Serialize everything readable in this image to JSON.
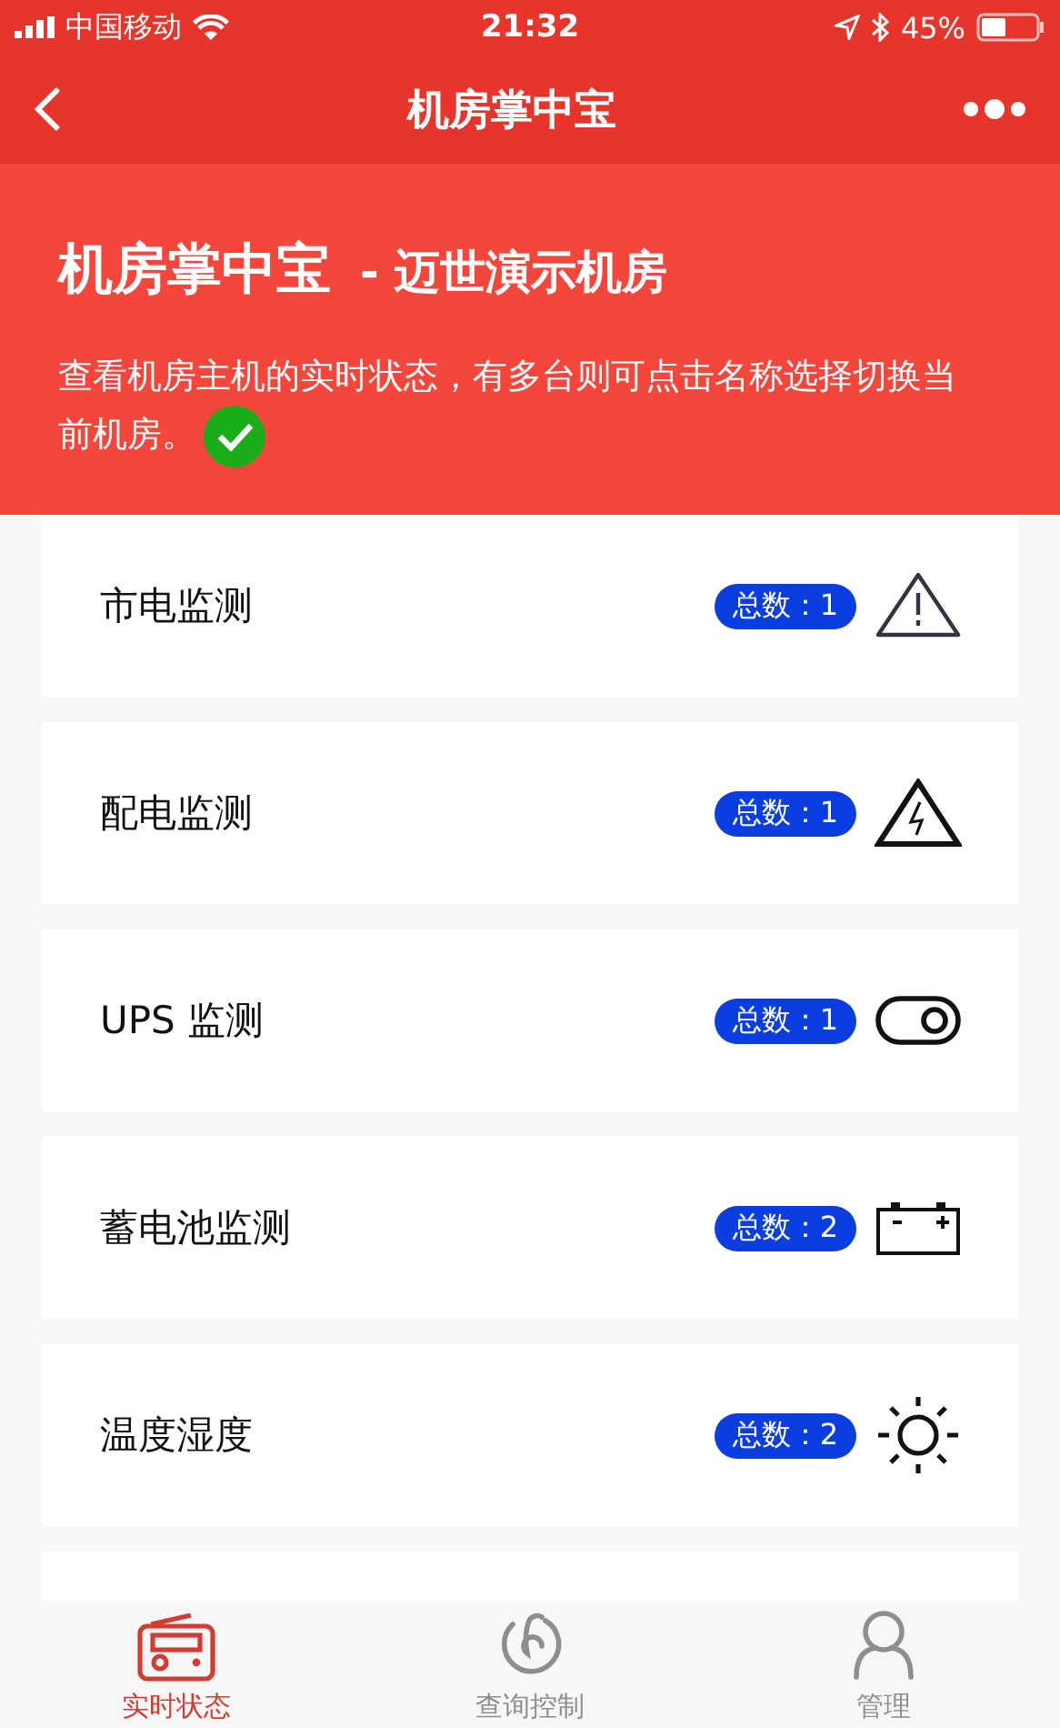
{
  "status_bar": {
    "carrier": "中国移动",
    "time": "21:32",
    "battery": "45%"
  },
  "nav": {
    "title": "机房掌中宝"
  },
  "banner": {
    "title": "机房掌中宝",
    "subtitle": "- 迈世演示机房",
    "description": "查看机房主机的实时状态，有多台则可点击名称选择切换当前机房。",
    "verified": true
  },
  "items": [
    {
      "name": "市电监测",
      "count": "总数：1",
      "kind": "warning"
    },
    {
      "name": "配电监测",
      "count": "总数：1",
      "kind": "electric"
    },
    {
      "name": "UPS 监测",
      "count": "总数：1",
      "kind": "toggle"
    },
    {
      "name": "蓄电池监测",
      "count": "总数：2",
      "kind": "battery"
    },
    {
      "name": "温度湿度",
      "count": "总数：2",
      "kind": "sun"
    }
  ],
  "tabs": [
    {
      "label": "实时状态",
      "kind": "radio",
      "selected": true
    },
    {
      "label": "查询控制",
      "kind": "swirl",
      "selected": false
    },
    {
      "label": "管理",
      "kind": "person",
      "selected": false
    }
  ]
}
